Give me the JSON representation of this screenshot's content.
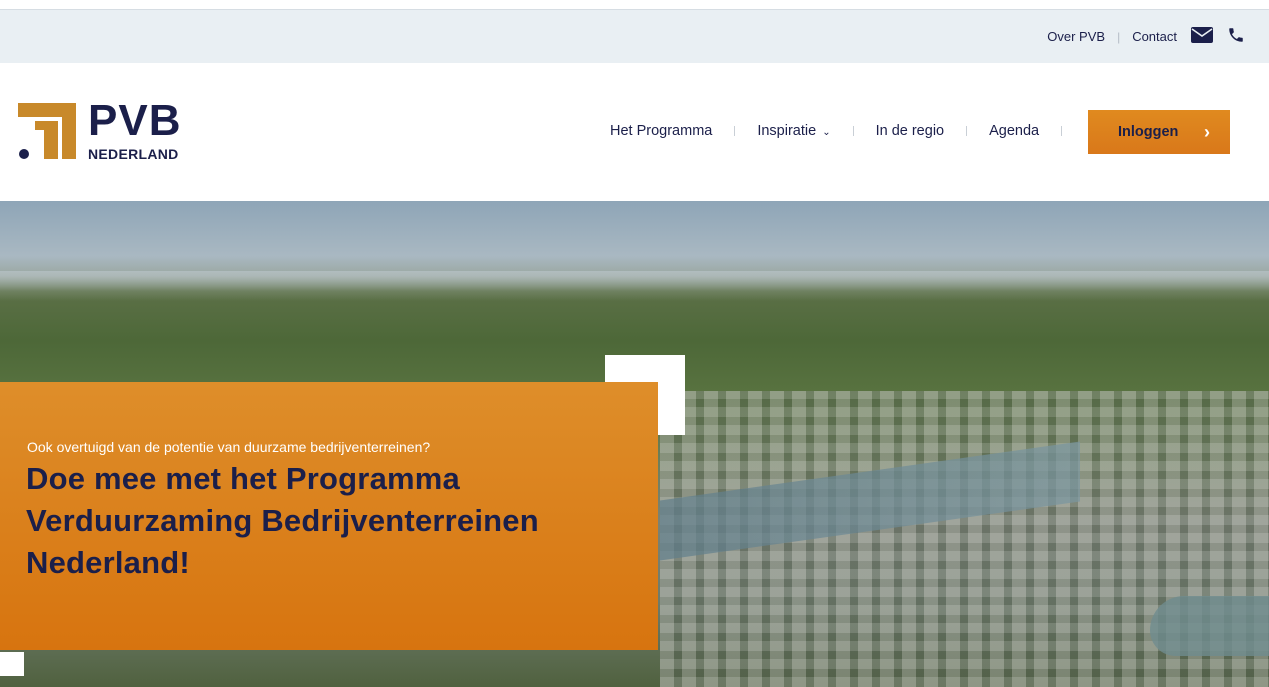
{
  "utility_bar": {
    "about_label": "Over PVB",
    "contact_label": "Contact",
    "icons": [
      "envelope-icon",
      "phone-icon"
    ]
  },
  "brand": {
    "name": "PVB",
    "subtitle": "NEDERLAND"
  },
  "nav": {
    "items": [
      {
        "label": "Het Programma"
      },
      {
        "label": "Inspiratie",
        "has_dropdown": true
      },
      {
        "label": "In de regio"
      },
      {
        "label": "Agenda"
      }
    ],
    "login_label": "Inloggen"
  },
  "hero": {
    "kicker": "Ook overtuigd van de potentie van duurzame bedrijventerreinen?",
    "headline": "Doe mee met het Programma Verduurzaming Bedrijventerreinen Nederland!"
  },
  "colors": {
    "navy": "#1b1f4a",
    "orange": "#d9781a",
    "utility_bg": "#e9eff3"
  }
}
